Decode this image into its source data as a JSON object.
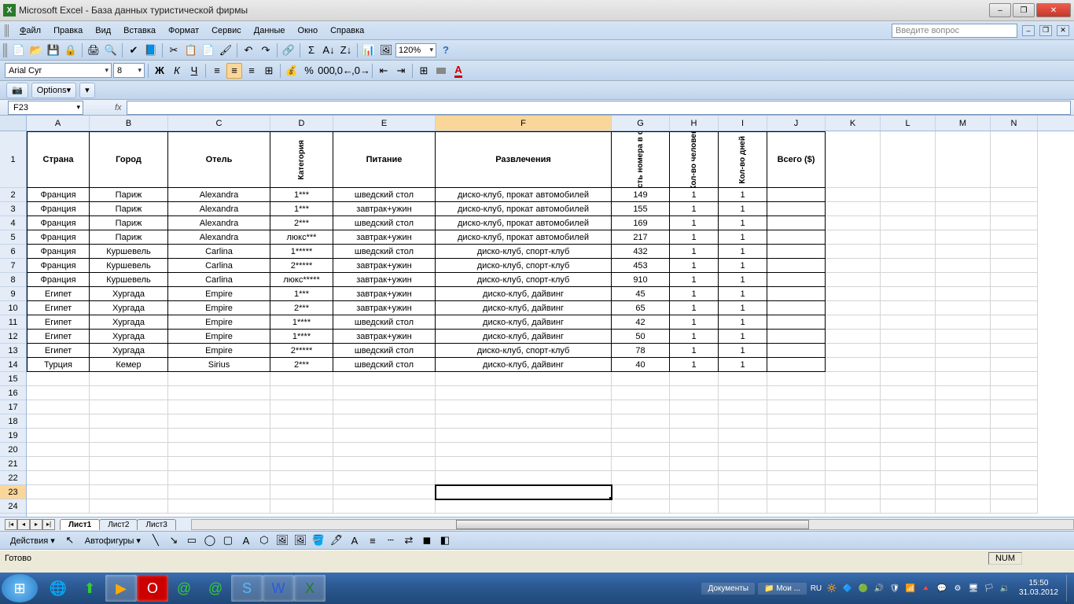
{
  "window": {
    "app": "Microsoft Excel",
    "docTitle": "База данных туристической фирмы"
  },
  "menu": {
    "file": "Файл",
    "edit": "Правка",
    "view": "Вид",
    "insert": "Вставка",
    "format": "Формат",
    "tools": "Сервис",
    "data": "Данные",
    "window": "Окно",
    "help": "Справка",
    "questionPlaceholder": "Введите вопрос"
  },
  "toolbar": {
    "zoom": "120%"
  },
  "format": {
    "fontName": "Arial Cyr",
    "fontSize": "8"
  },
  "options": {
    "label": "Options"
  },
  "namebox": {
    "ref": "F23",
    "fx": "fx"
  },
  "columns": [
    "A",
    "B",
    "C",
    "D",
    "E",
    "F",
    "G",
    "H",
    "I",
    "J",
    "K",
    "L",
    "M",
    "N"
  ],
  "headers": {
    "A": "Страна",
    "B": "Город",
    "C": "Отель",
    "D": "Категория",
    "E": "Питание",
    "F": "Развлечения",
    "G": "Стоимость номера в сутки ($)",
    "H": "Кол-во человек",
    "I": "Кол-во дней",
    "J": "Всего ($)"
  },
  "rows": [
    {
      "A": "Франция",
      "B": "Париж",
      "C": "Alexandra",
      "D": "1***",
      "E": "шведский стол",
      "F": "диско-клуб, прокат автомобилей",
      "G": "149",
      "H": "1",
      "I": "1",
      "J": ""
    },
    {
      "A": "Франция",
      "B": "Париж",
      "C": "Alexandra",
      "D": "1***",
      "E": "завтрак+ужин",
      "F": "диско-клуб, прокат автомобилей",
      "G": "155",
      "H": "1",
      "I": "1",
      "J": ""
    },
    {
      "A": "Франция",
      "B": "Париж",
      "C": "Alexandra",
      "D": "2***",
      "E": "шведский стол",
      "F": "диско-клуб, прокат автомобилей",
      "G": "169",
      "H": "1",
      "I": "1",
      "J": ""
    },
    {
      "A": "Франция",
      "B": "Париж",
      "C": "Alexandra",
      "D": "люкс***",
      "E": "завтрак+ужин",
      "F": "диско-клуб, прокат автомобилей",
      "G": "217",
      "H": "1",
      "I": "1",
      "J": ""
    },
    {
      "A": "Франция",
      "B": "Куршевель",
      "C": "Carlina",
      "D": "1*****",
      "E": "шведский стол",
      "F": "диско-клуб, спорт-клуб",
      "G": "432",
      "H": "1",
      "I": "1",
      "J": ""
    },
    {
      "A": "Франция",
      "B": "Куршевель",
      "C": "Carlina",
      "D": "2*****",
      "E": "завтрак+ужин",
      "F": "диско-клуб, спорт-клуб",
      "G": "453",
      "H": "1",
      "I": "1",
      "J": ""
    },
    {
      "A": "Франция",
      "B": "Куршевель",
      "C": "Carlina",
      "D": "люкс*****",
      "E": "завтрак+ужин",
      "F": "диско-клуб, спорт-клуб",
      "G": "910",
      "H": "1",
      "I": "1",
      "J": ""
    },
    {
      "A": "Египет",
      "B": "Хургада",
      "C": "Empire",
      "D": "1***",
      "E": "завтрак+ужин",
      "F": "диско-клуб, дайвинг",
      "G": "45",
      "H": "1",
      "I": "1",
      "J": ""
    },
    {
      "A": "Египет",
      "B": "Хургада",
      "C": "Empire",
      "D": "2***",
      "E": "завтрак+ужин",
      "F": "диско-клуб, дайвинг",
      "G": "65",
      "H": "1",
      "I": "1",
      "J": ""
    },
    {
      "A": "Египет",
      "B": "Хургада",
      "C": "Empire",
      "D": "1****",
      "E": "шведский стол",
      "F": "диско-клуб, дайвинг",
      "G": "42",
      "H": "1",
      "I": "1",
      "J": ""
    },
    {
      "A": "Египет",
      "B": "Хургада",
      "C": "Empire",
      "D": "1****",
      "E": "завтрак+ужин",
      "F": "диско-клуб, дайвинг",
      "G": "50",
      "H": "1",
      "I": "1",
      "J": ""
    },
    {
      "A": "Египет",
      "B": "Хургада",
      "C": "Empire",
      "D": "2*****",
      "E": "шведский стол",
      "F": "диско-клуб, спорт-клуб",
      "G": "78",
      "H": "1",
      "I": "1",
      "J": ""
    },
    {
      "A": "Турция",
      "B": "Кемер",
      "C": "Sirius",
      "D": "2***",
      "E": "шведский стол",
      "F": "диско-клуб, дайвинг",
      "G": "40",
      "H": "1",
      "I": "1",
      "J": ""
    }
  ],
  "emptyRows": [
    15,
    16,
    17,
    18,
    19,
    20,
    21,
    22,
    23,
    24
  ],
  "selectedRow": 23,
  "selectedCol": "F",
  "tabs": {
    "sheet1": "Лист1",
    "sheet2": "Лист2",
    "sheet3": "Лист3"
  },
  "drawbar": {
    "actions": "Действия",
    "autoshapes": "Автофигуры"
  },
  "status": {
    "ready": "Готово",
    "num": "NUM"
  },
  "taskbar": {
    "docs": "Документы",
    "my": "Мои ...",
    "lang": "RU",
    "time": "15:50",
    "date": "31.03.2012"
  }
}
